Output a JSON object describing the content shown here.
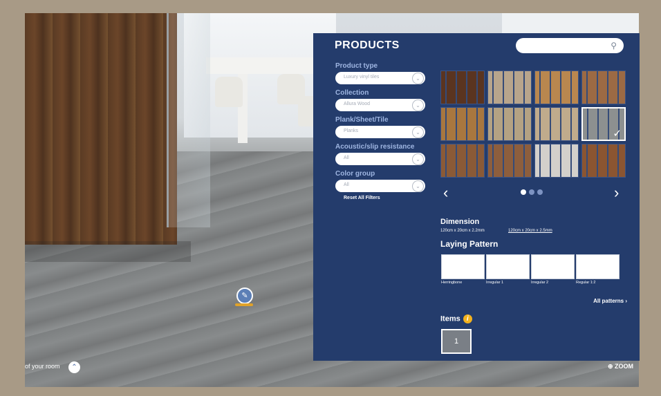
{
  "room": {
    "bottom_text": "of your room",
    "zoom_label": "ZOOM"
  },
  "panel": {
    "title": "PRODUCTS",
    "search": {
      "placeholder": ""
    },
    "filters": [
      {
        "label": "Product type",
        "value": "Luxury vinyl tiles"
      },
      {
        "label": "Collection",
        "value": "Allura Wood"
      },
      {
        "label": "Plank/Sheet/Tile",
        "value": "Planks"
      },
      {
        "label": "Acoustic/slip resistance",
        "value": "All"
      },
      {
        "label": "Color group",
        "value": "All"
      }
    ],
    "reset_label": "Reset All Filters",
    "swatch_colors": [
      "#5a3420",
      "#b8a58c",
      "#b9874f",
      "#9c6a44",
      "#a8773f",
      "#b4a283",
      "#c0ab8c",
      "#8d9090",
      "#8a5a37",
      "#8d5e3d",
      "#d3d0cb",
      "#8b5531"
    ],
    "selected_swatch": 8,
    "carousel": {
      "prev": "‹",
      "next": "›",
      "pages": 3,
      "active_page": 1
    },
    "dimension": {
      "title": "Dimension",
      "options": [
        "120cm x 20cm x 2.2mm",
        "120cm x 20cm x 2.5mm"
      ]
    },
    "laying_pattern": {
      "title": "Laying Pattern",
      "patterns": [
        {
          "label": "Herringbone"
        },
        {
          "label": "Irregular 1"
        },
        {
          "label": "Irregular 2"
        },
        {
          "label": "Regular 1:2"
        }
      ],
      "all_patterns": "All patterns"
    },
    "items": {
      "title": "Items",
      "count": "1"
    }
  }
}
